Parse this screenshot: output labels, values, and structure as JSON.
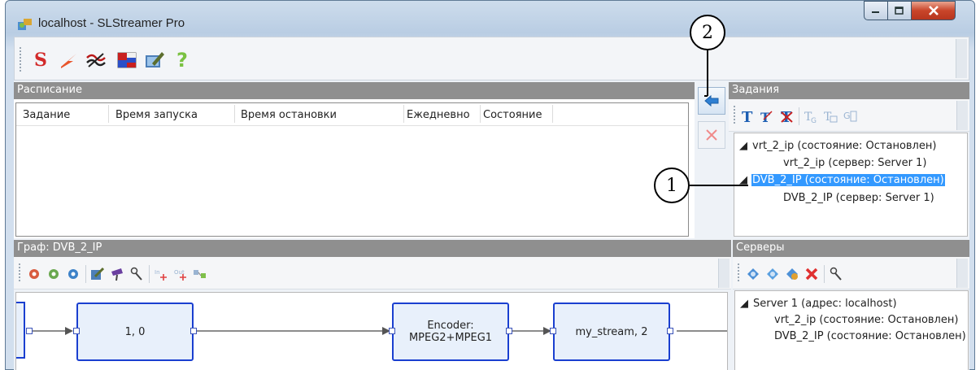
{
  "window": {
    "title": "localhost - SLStreamer Pro"
  },
  "toolbar": {
    "icons": [
      "slstreamer-s-icon",
      "lightning-icon",
      "signal-icon",
      "flags-icon",
      "edit-icon",
      "help-icon"
    ],
    "help_glyph": "?",
    "s_glyph": "S"
  },
  "schedule": {
    "header": "Расписание",
    "columns": [
      "Задание",
      "Время запуска",
      "Время остановки",
      "Ежедневно",
      "Состояние"
    ]
  },
  "tasks": {
    "header": "Задания",
    "tree": [
      {
        "label": "vrt_2_ip (состояние: Остановлен)",
        "expanded": true,
        "selected": false
      },
      {
        "label": "vrt_2_ip (сервер: Server 1)"
      },
      {
        "label": "DVB_2_IP (состояние: Остановлен)",
        "expanded": true,
        "selected": true
      },
      {
        "label": "DVB_2_IP (сервер: Server 1)"
      }
    ]
  },
  "graph": {
    "header": "Граф: DVB_2_IP",
    "nodes": [
      {
        "label": "1, 0"
      },
      {
        "label_line1": "Encoder:",
        "label_line2": "MPEG2+MPEG1"
      },
      {
        "label": "my_stream, 2"
      }
    ]
  },
  "servers": {
    "header": "Серверы",
    "tree": [
      {
        "label": "Server 1 (адрес: localhost)"
      },
      {
        "label": "vrt_2_ip (состояние: Остановлен)"
      },
      {
        "label": "DVB_2_IP (состояние: Остановлен)"
      }
    ]
  },
  "callouts": [
    "1",
    "2"
  ],
  "colors": {
    "accent_blue": "#3399ff",
    "node_border": "#1a3fd0",
    "panel_header": "#8f8f8f",
    "delete_red": "#e03030"
  }
}
